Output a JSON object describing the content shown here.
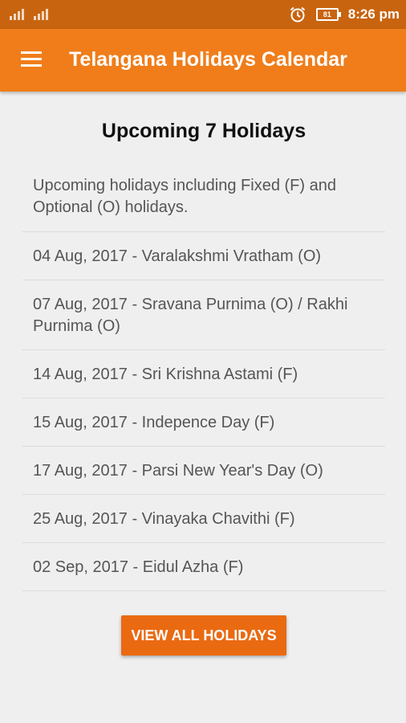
{
  "status_bar": {
    "battery": "81",
    "time": "8:26 pm",
    "icons": [
      "signal-icon",
      "signal-icon",
      "alarm-icon",
      "battery-icon"
    ]
  },
  "app_bar": {
    "title": "Telangana Holidays Calendar",
    "menu_icon": "menu-icon"
  },
  "colors": {
    "status_bar": "#c8640f",
    "app_bar": "#f07d1a",
    "button": "#ea6a12",
    "background": "#efefef"
  },
  "main": {
    "heading": "Upcoming 7 Holidays",
    "intro": "Upcoming holidays including Fixed (F) and Optional (O) holidays.",
    "holidays": [
      "04 Aug, 2017 - Varalakshmi Vratham (O)",
      "07 Aug, 2017 - Sravana Purnima (O) / Rakhi Purnima (O)",
      "14 Aug, 2017 - Sri Krishna Astami (F)",
      "15 Aug, 2017 - Indepence Day (F)",
      "17 Aug, 2017 - Parsi New Year's Day (O)",
      "25 Aug, 2017 - Vinayaka Chavithi (F)",
      "02 Sep, 2017 - Eidul Azha (F)"
    ],
    "button_label": "VIEW ALL HOLIDAYS"
  }
}
